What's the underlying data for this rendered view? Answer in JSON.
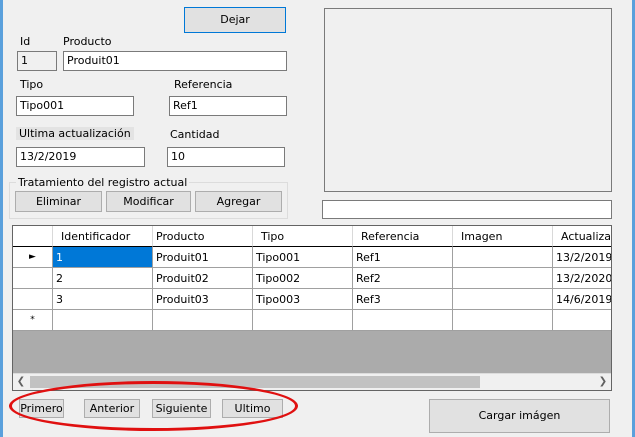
{
  "buttons": {
    "dejar": "Dejar",
    "eliminar": "Eliminar",
    "modificar": "Modificar",
    "agregar": "Agregar",
    "primero": "Primero",
    "anterior": "Anterior",
    "siguiente": "Siguiente",
    "ultimo": "Ultimo",
    "cargar": "Cargar imágen"
  },
  "fields": {
    "id_label": "Id",
    "id_value": "1",
    "producto_label": "Producto",
    "producto_value": "Produit01",
    "tipo_label": "Tipo",
    "tipo_value": "Tipo001",
    "referencia_label": "Referencia",
    "referencia_value": "Ref1",
    "ultima_label": "Ultima actualización",
    "ultima_value": "13/2/2019",
    "cantidad_label": "Cantidad",
    "cantidad_value": "10"
  },
  "group": {
    "title": "Tratamiento del registro actual"
  },
  "grid": {
    "columns": [
      "Identificador",
      "Producto",
      "Tipo",
      "Referencia",
      "Imagen",
      "Actualizaci"
    ],
    "rows": [
      [
        "1",
        "Produit01",
        "Tipo001",
        "Ref1",
        "",
        "13/2/2019"
      ],
      [
        "2",
        "Produit02",
        "Tipo002",
        "Ref2",
        "",
        "13/2/2020"
      ],
      [
        "3",
        "Produit03",
        "Tipo003",
        "Ref3",
        "",
        "14/6/2019"
      ]
    ],
    "row_markers": [
      "►",
      "",
      "",
      "*"
    ]
  },
  "colors": {
    "accent": "#0078d7",
    "highlight_ellipse": "#e01010",
    "window_border": "#5aa0dc"
  }
}
